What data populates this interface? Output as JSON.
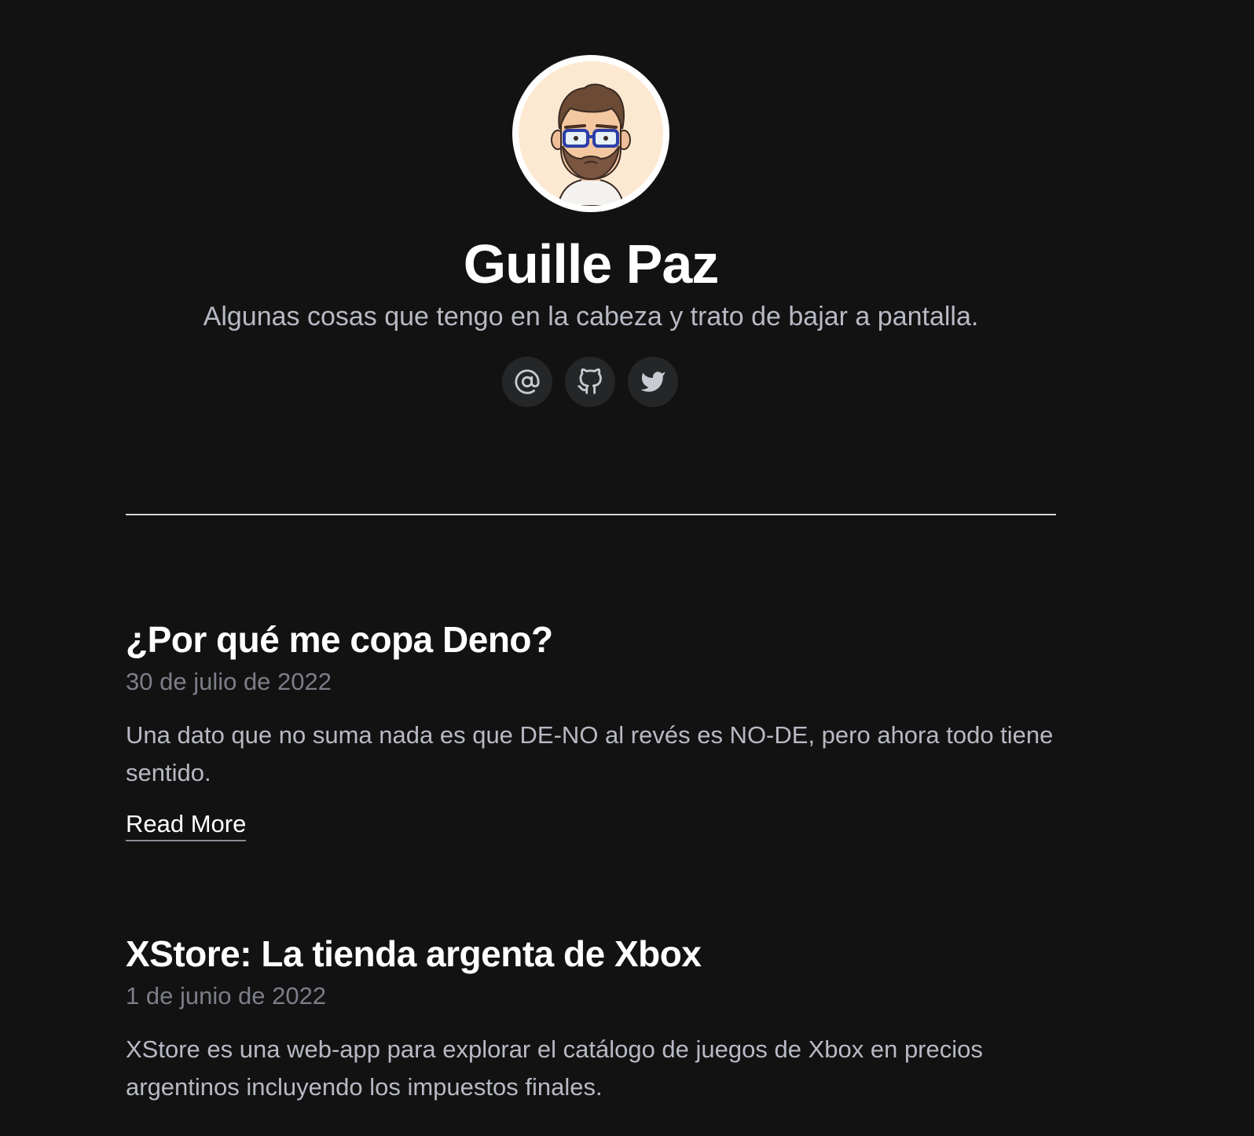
{
  "profile": {
    "name": "Guille Paz",
    "tagline": "Algunas cosas que tengo en la cabeza y trato de bajar a pantalla.",
    "avatar_icon": "cartoon-avatar-bearded-man-glasses"
  },
  "socials": [
    {
      "icon": "at-sign-icon",
      "label": "Email"
    },
    {
      "icon": "github-icon",
      "label": "GitHub"
    },
    {
      "icon": "twitter-icon",
      "label": "Twitter"
    }
  ],
  "posts": [
    {
      "title": "¿Por qué me copa Deno?",
      "date": "30 de julio de 2022",
      "excerpt": "Una dato que no suma nada es que DE-NO al revés es NO-DE, pero ahora todo tiene sentido.",
      "read_more": "Read More"
    },
    {
      "title": "XStore: La tienda argenta de Xbox",
      "date": "1 de junio de 2022",
      "excerpt": "XStore es una web-app para explorar el catálogo de juegos de Xbox en precios argentinos incluyendo los impuestos finales."
    }
  ],
  "colors": {
    "background": "#121212",
    "title": "#ffffff",
    "muted": "#b7b9c4",
    "date": "#7c7e88",
    "icon_bg": "#252628",
    "avatar_bg": "#fde9d2"
  }
}
